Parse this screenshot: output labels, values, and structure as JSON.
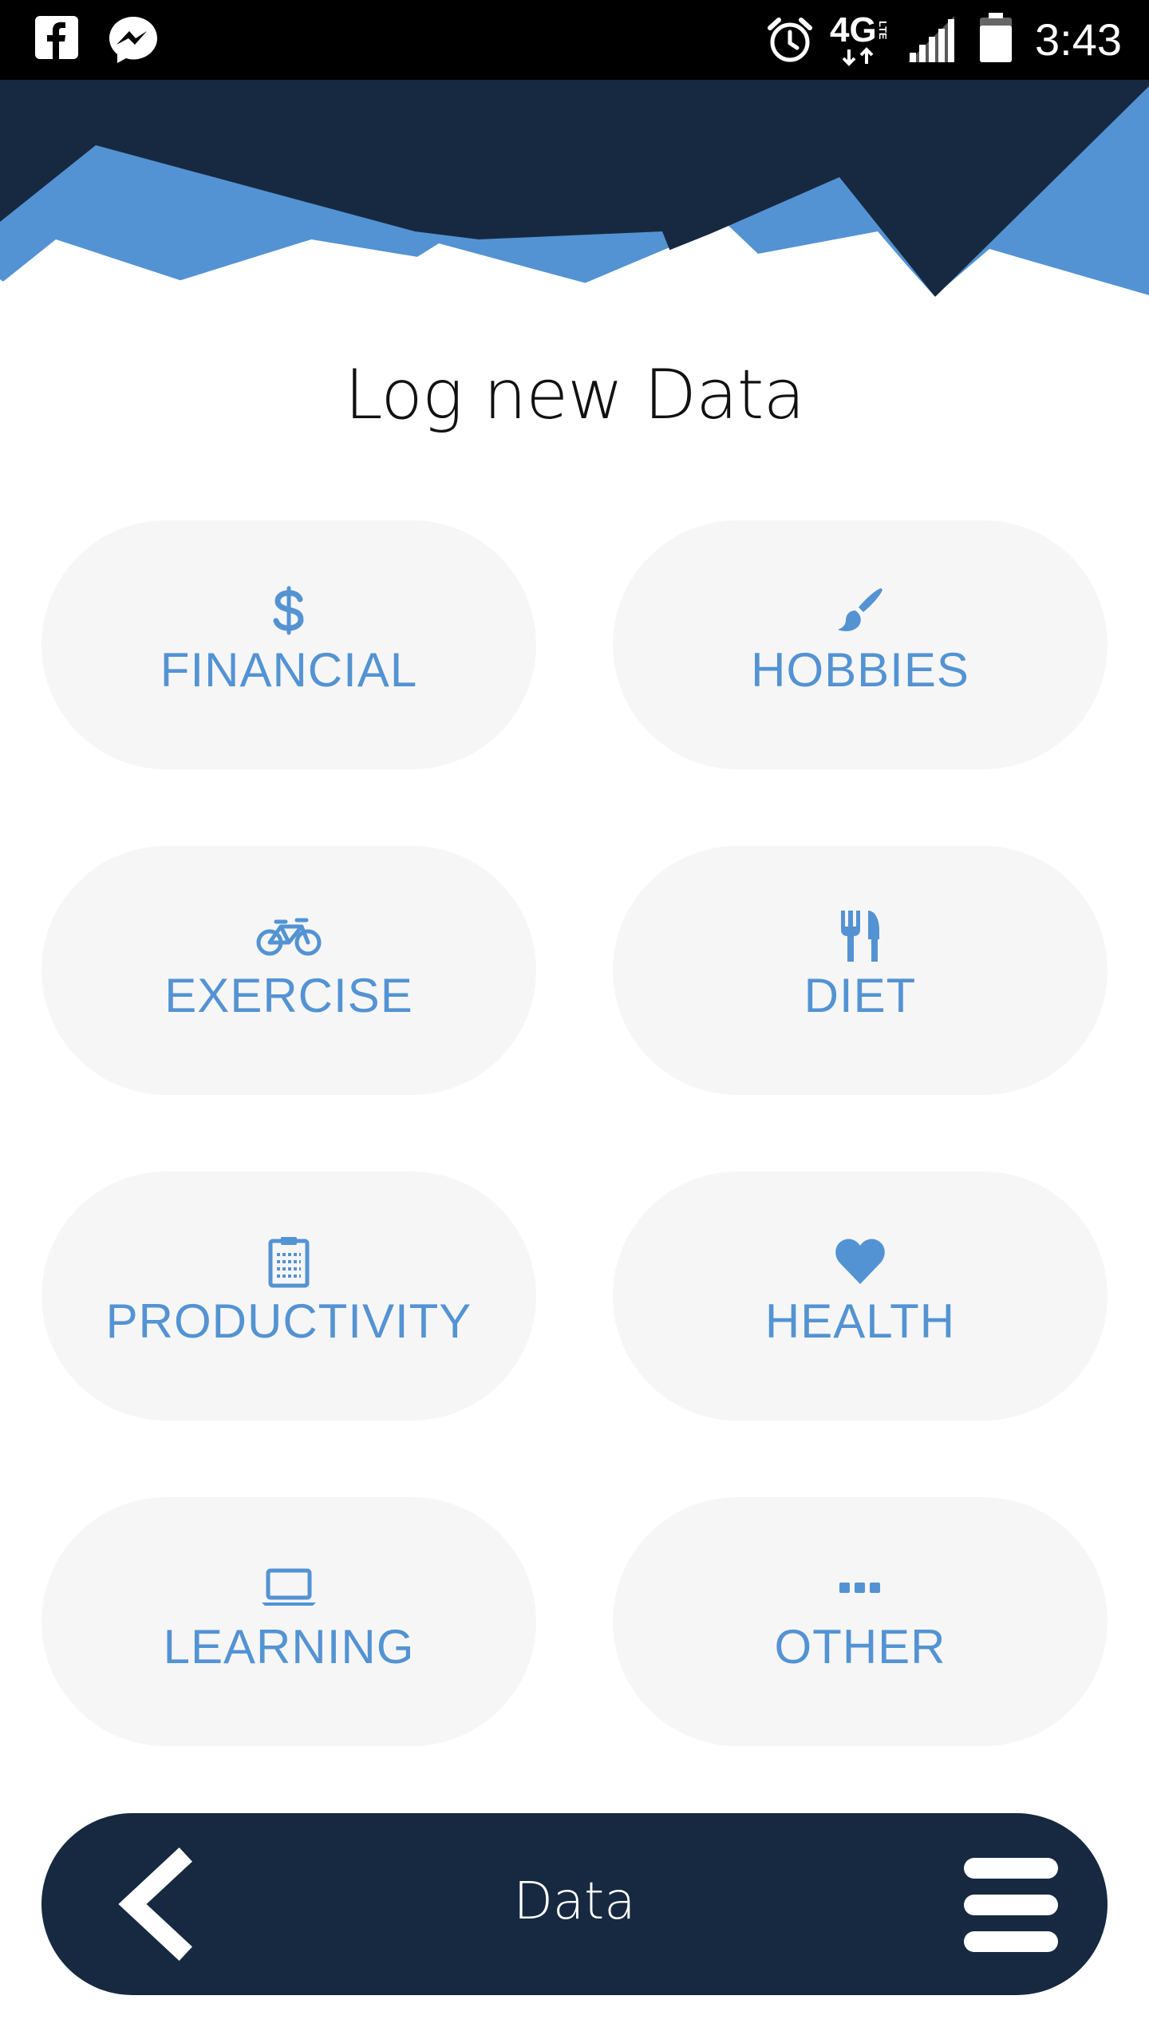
{
  "status_bar": {
    "time": "3:43",
    "left_icons": [
      "facebook-icon",
      "messenger-icon"
    ],
    "right_icons": [
      "alarm-icon",
      "lte-icon",
      "signal-icon",
      "battery-icon"
    ],
    "network_label": "4G",
    "network_sub": "LTE"
  },
  "page": {
    "title": "Log new Data"
  },
  "categories": [
    {
      "label": "FINANCIAL",
      "icon": "dollar-icon"
    },
    {
      "label": "HOBBIES",
      "icon": "paintbrush-icon"
    },
    {
      "label": "EXERCISE",
      "icon": "bicycle-icon"
    },
    {
      "label": "DIET",
      "icon": "utensils-icon"
    },
    {
      "label": "PRODUCTIVITY",
      "icon": "clipboard-icon"
    },
    {
      "label": "HEALTH",
      "icon": "heart-icon"
    },
    {
      "label": "LEARNING",
      "icon": "laptop-icon"
    },
    {
      "label": "OTHER",
      "icon": "ellipsis-icon"
    }
  ],
  "bottom_nav": {
    "title": "Data",
    "back_icon": "chevron-left-icon",
    "menu_icon": "hamburger-menu-icon"
  },
  "colors": {
    "accent": "#5393d3",
    "navy": "#172941",
    "button_bg": "#f6f6f6"
  }
}
